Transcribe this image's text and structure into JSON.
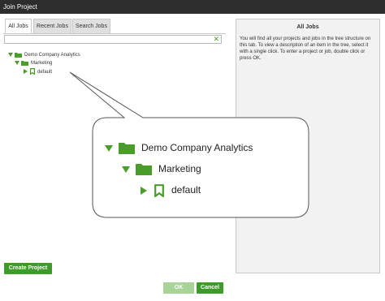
{
  "window": {
    "title": "Join Project"
  },
  "tabs": [
    {
      "label": "All Jobs",
      "active": true
    },
    {
      "label": "Recent Jobs",
      "active": false
    },
    {
      "label": "Search Jobs",
      "active": false
    }
  ],
  "search": {
    "value": "",
    "clear_icon": "x-icon"
  },
  "tree": [
    {
      "label": "Demo Company Analytics",
      "icon": "folder-icon",
      "expanded": true
    },
    {
      "label": "Marketing",
      "icon": "folder-icon",
      "expanded": true
    },
    {
      "label": "default",
      "icon": "bookmark-icon",
      "expanded": false
    }
  ],
  "info": {
    "title": "All Jobs",
    "description": "You will find all your projects and jobs in the tree structure on this tab. To view a description of an item in the tree, select it with a single click. To enter a project or job, double click or press OK."
  },
  "buttons": {
    "create_project": "Create Project",
    "ok": "OK",
    "cancel": "Cancel"
  },
  "colors": {
    "accent": "#3e9b2b",
    "titlebar": "#2d2d2d",
    "ok_disabled": "#a8d49a"
  }
}
